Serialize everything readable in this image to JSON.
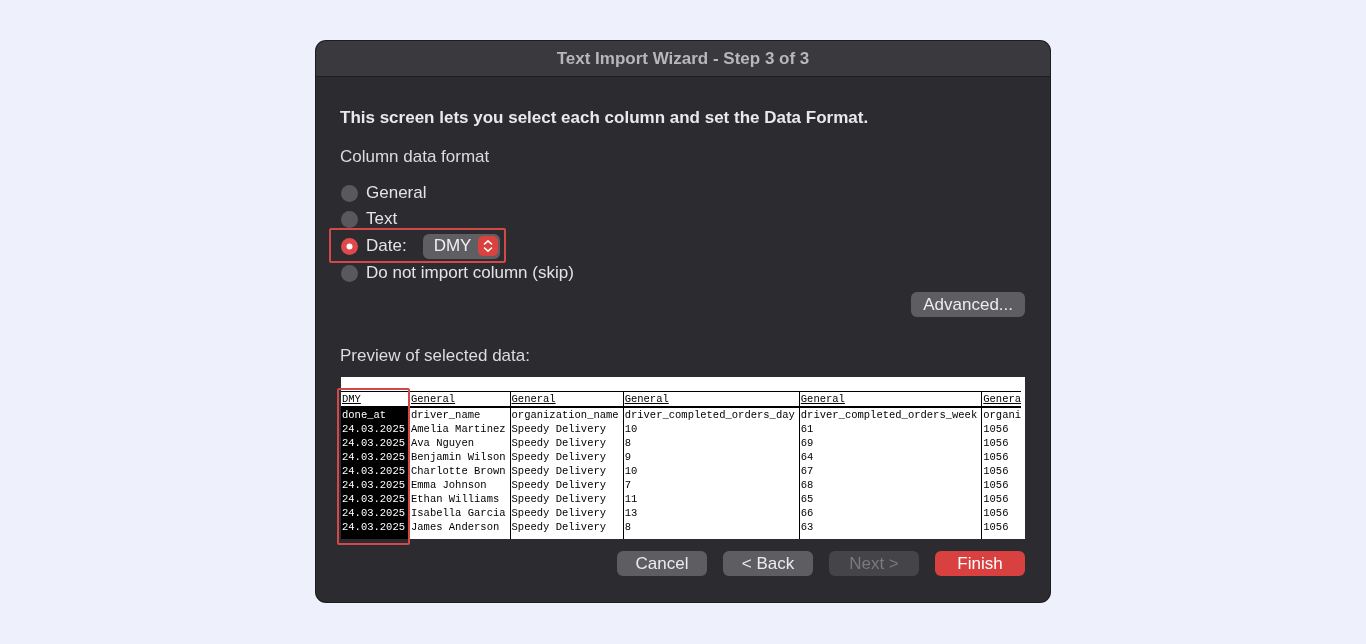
{
  "window": {
    "title": "Text Import Wizard - Step 3 of 3"
  },
  "instruction": "This screen lets you select each column and set the Data Format.",
  "column_data_format": {
    "label": "Column data format",
    "options": [
      {
        "label": "General",
        "selected": false,
        "highlighted": false
      },
      {
        "label": "Text",
        "selected": false,
        "highlighted": false
      },
      {
        "label": "Date:",
        "selected": true,
        "highlighted": true,
        "select": {
          "value": "DMY"
        }
      },
      {
        "label": "Do not import column (skip)",
        "selected": false,
        "highlighted": false
      }
    ]
  },
  "advanced_button": {
    "label": "Advanced..."
  },
  "preview": {
    "label": "Preview of selected data:",
    "columns": [
      {
        "format": "DMY",
        "selected": true,
        "highlighted": true
      },
      {
        "format": "General",
        "selected": false,
        "highlighted": false
      },
      {
        "format": "General",
        "selected": false,
        "highlighted": false
      },
      {
        "format": "General",
        "selected": false,
        "highlighted": false
      },
      {
        "format": "General",
        "selected": false,
        "highlighted": false
      },
      {
        "format": "Genera",
        "selected": false,
        "highlighted": false
      }
    ],
    "rows": [
      [
        "done_at",
        "driver_name",
        "organization_name",
        "driver_completed_orders_day",
        "driver_completed_orders_week",
        "organi"
      ],
      [
        "24.03.2025",
        "Amelia Martinez",
        "Speedy Delivery",
        "10",
        "61",
        "1056"
      ],
      [
        "24.03.2025",
        "Ava Nguyen",
        "Speedy Delivery",
        "8",
        "69",
        "1056"
      ],
      [
        "24.03.2025",
        "Benjamin Wilson",
        "Speedy Delivery",
        "9",
        "64",
        "1056"
      ],
      [
        "24.03.2025",
        "Charlotte Brown",
        "Speedy Delivery",
        "10",
        "67",
        "1056"
      ],
      [
        "24.03.2025",
        "Emma Johnson",
        "Speedy Delivery",
        "7",
        "68",
        "1056"
      ],
      [
        "24.03.2025",
        "Ethan Williams",
        "Speedy Delivery",
        "11",
        "65",
        "1056"
      ],
      [
        "24.03.2025",
        "Isabella Garcia",
        "Speedy Delivery",
        "13",
        "66",
        "1056"
      ],
      [
        "24.03.2025",
        "James Anderson",
        "Speedy Delivery",
        "8",
        "63",
        "1056"
      ]
    ]
  },
  "buttons": [
    {
      "label": "Cancel",
      "kind": "push",
      "disabled": false
    },
    {
      "label": "< Back",
      "kind": "push",
      "disabled": false
    },
    {
      "label": "Next >",
      "kind": "push",
      "disabled": true
    },
    {
      "label": "Finish",
      "kind": "default",
      "disabled": false
    }
  ]
}
